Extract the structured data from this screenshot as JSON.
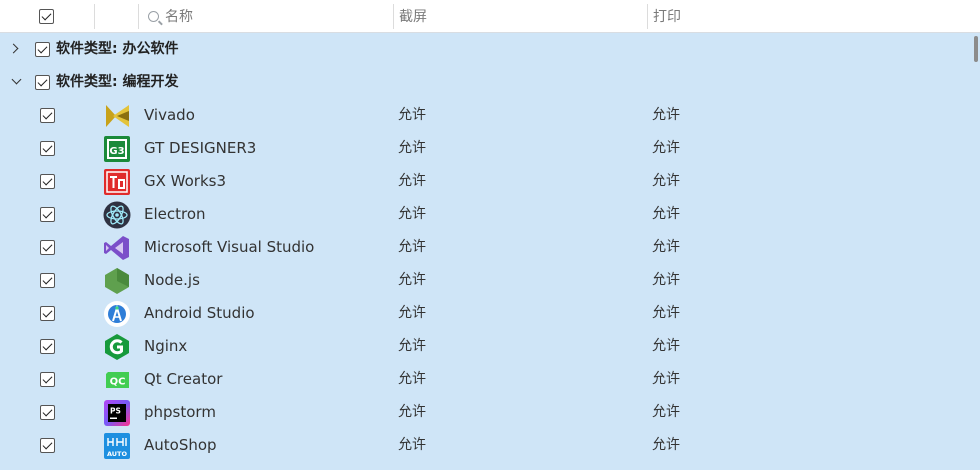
{
  "header": {
    "name_label": "名称",
    "screenshot_label": "截屏",
    "print_label": "打印"
  },
  "groups": [
    {
      "label": "软件类型: 办公软件",
      "expanded": false
    },
    {
      "label": "软件类型: 编程开发",
      "expanded": true
    }
  ],
  "apps": [
    {
      "name": "Vivado",
      "screenshot": "允许",
      "print": "允许",
      "icon": "vivado-icon"
    },
    {
      "name": "GT DESIGNER3",
      "screenshot": "允许",
      "print": "允许",
      "icon": "gt-designer3-icon"
    },
    {
      "name": "GX Works3",
      "screenshot": "允许",
      "print": "允许",
      "icon": "gx-works3-icon"
    },
    {
      "name": "Electron",
      "screenshot": "允许",
      "print": "允许",
      "icon": "electron-icon"
    },
    {
      "name": "Microsoft Visual Studio",
      "screenshot": "允许",
      "print": "允许",
      "icon": "visual-studio-icon"
    },
    {
      "name": "Node.js",
      "screenshot": "允许",
      "print": "允许",
      "icon": "nodejs-icon"
    },
    {
      "name": "Android Studio",
      "screenshot": "允许",
      "print": "允许",
      "icon": "android-studio-icon"
    },
    {
      "name": "Nginx",
      "screenshot": "允许",
      "print": "允许",
      "icon": "nginx-icon"
    },
    {
      "name": "Qt Creator",
      "screenshot": "允许",
      "print": "允许",
      "icon": "qt-creator-icon"
    },
    {
      "name": "phpstorm",
      "screenshot": "允许",
      "print": "允许",
      "icon": "phpstorm-icon"
    },
    {
      "name": "AutoShop",
      "screenshot": "允许",
      "print": "允许",
      "icon": "autoshop-icon"
    }
  ],
  "icon_text": {
    "gx": "口",
    "qt": "QC",
    "ps": "PS",
    "auto": "AUTO",
    "gt": "G3"
  },
  "colors": {
    "row_background": "#cfe5f7",
    "header_background": "#ffffff"
  }
}
